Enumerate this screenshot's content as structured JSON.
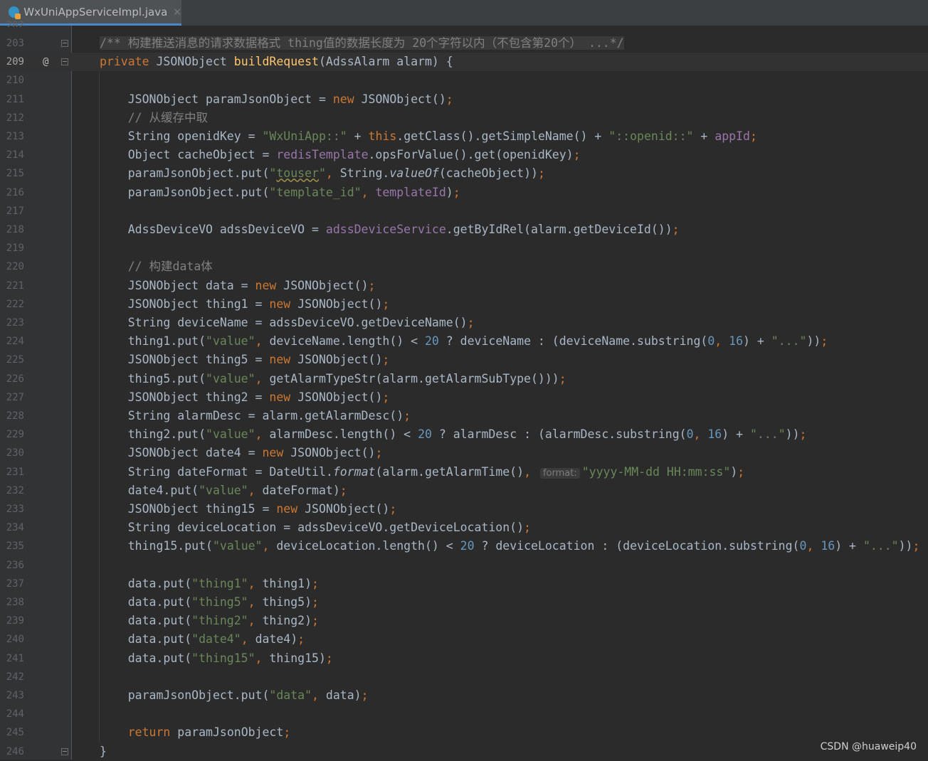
{
  "tab": {
    "filename": "WxUniAppServiceImpl.java",
    "close_icon": "×"
  },
  "watermark": "CSDN @huaweip40",
  "partial_line_number": "202",
  "lines": [
    {
      "n": "203",
      "fold": true,
      "tokens": [
        {
          "t": "/** 构建推送消息的请求数据格式 thing值的数据长度为 20个字符以内（不包含第20个） ...*/",
          "c": "cmt doc"
        }
      ]
    },
    {
      "n": "209",
      "current": true,
      "marker": "@",
      "fold": true,
      "tokens": [
        {
          "t": "private ",
          "c": "kw"
        },
        {
          "t": "JSONObject ",
          "c": "plain"
        },
        {
          "t": "buildRequest",
          "c": "fn"
        },
        {
          "t": "(AdssAlarm alarm) {",
          "c": "plain"
        }
      ]
    },
    {
      "n": "210",
      "tokens": []
    },
    {
      "n": "211",
      "tokens": [
        {
          "t": "    JSONObject paramJsonObject = ",
          "c": "plain"
        },
        {
          "t": "new ",
          "c": "kw"
        },
        {
          "t": "JSONObject()",
          "c": "plain"
        },
        {
          "t": ";",
          "c": "kw"
        }
      ]
    },
    {
      "n": "212",
      "tokens": [
        {
          "t": "    // 从缓存中取",
          "c": "cmt"
        }
      ]
    },
    {
      "n": "213",
      "tokens": [
        {
          "t": "    String openidKey = ",
          "c": "plain"
        },
        {
          "t": "\"WxUniApp::\"",
          "c": "str"
        },
        {
          "t": " + ",
          "c": "plain"
        },
        {
          "t": "this",
          "c": "kw"
        },
        {
          "t": ".getClass().getSimpleName() + ",
          "c": "plain"
        },
        {
          "t": "\"::openid::\"",
          "c": "str"
        },
        {
          "t": " + ",
          "c": "plain"
        },
        {
          "t": "appId",
          "c": "fld"
        },
        {
          "t": ";",
          "c": "kw"
        }
      ]
    },
    {
      "n": "214",
      "tokens": [
        {
          "t": "    Object cacheObject = ",
          "c": "plain"
        },
        {
          "t": "redisTemplate",
          "c": "fld"
        },
        {
          "t": ".opsForValue().get(openidKey)",
          "c": "plain"
        },
        {
          "t": ";",
          "c": "kw"
        }
      ]
    },
    {
      "n": "215",
      "tokens": [
        {
          "t": "    paramJsonObject.put(",
          "c": "plain"
        },
        {
          "t": "\"",
          "c": "str"
        },
        {
          "t": "touser",
          "c": "str ul"
        },
        {
          "t": "\"",
          "c": "str"
        },
        {
          "t": ", ",
          "c": "kw"
        },
        {
          "t": "String.",
          "c": "plain"
        },
        {
          "t": "valueOf",
          "c": "plain it"
        },
        {
          "t": "(cacheObject))",
          "c": "plain"
        },
        {
          "t": ";",
          "c": "kw"
        }
      ]
    },
    {
      "n": "216",
      "tokens": [
        {
          "t": "    paramJsonObject.put(",
          "c": "plain"
        },
        {
          "t": "\"template_id\"",
          "c": "str"
        },
        {
          "t": ", ",
          "c": "kw"
        },
        {
          "t": "templateId",
          "c": "fld"
        },
        {
          "t": ")",
          "c": "plain"
        },
        {
          "t": ";",
          "c": "kw"
        }
      ]
    },
    {
      "n": "217",
      "tokens": []
    },
    {
      "n": "218",
      "tokens": [
        {
          "t": "    AdssDeviceVO adssDeviceVO = ",
          "c": "plain"
        },
        {
          "t": "adssDeviceService",
          "c": "fld"
        },
        {
          "t": ".getByIdRel(alarm.getDeviceId())",
          "c": "plain"
        },
        {
          "t": ";",
          "c": "kw"
        }
      ]
    },
    {
      "n": "219",
      "tokens": []
    },
    {
      "n": "220",
      "tokens": [
        {
          "t": "    // 构建data体",
          "c": "cmt"
        }
      ]
    },
    {
      "n": "221",
      "tokens": [
        {
          "t": "    JSONObject data = ",
          "c": "plain"
        },
        {
          "t": "new ",
          "c": "kw"
        },
        {
          "t": "JSONObject()",
          "c": "plain"
        },
        {
          "t": ";",
          "c": "kw"
        }
      ]
    },
    {
      "n": "222",
      "tokens": [
        {
          "t": "    JSONObject thing1 = ",
          "c": "plain"
        },
        {
          "t": "new ",
          "c": "kw"
        },
        {
          "t": "JSONObject()",
          "c": "plain"
        },
        {
          "t": ";",
          "c": "kw"
        }
      ]
    },
    {
      "n": "223",
      "tokens": [
        {
          "t": "    String deviceName = adssDeviceVO.getDeviceName()",
          "c": "plain"
        },
        {
          "t": ";",
          "c": "kw"
        }
      ]
    },
    {
      "n": "224",
      "tokens": [
        {
          "t": "    thing1.put(",
          "c": "plain"
        },
        {
          "t": "\"value\"",
          "c": "str"
        },
        {
          "t": ", ",
          "c": "kw"
        },
        {
          "t": "deviceName.length() < ",
          "c": "plain"
        },
        {
          "t": "20",
          "c": "num"
        },
        {
          "t": " ? deviceName : (deviceName.substring(",
          "c": "plain"
        },
        {
          "t": "0",
          "c": "num"
        },
        {
          "t": ", ",
          "c": "kw"
        },
        {
          "t": "16",
          "c": "num"
        },
        {
          "t": ") + ",
          "c": "plain"
        },
        {
          "t": "\"...\"",
          "c": "str"
        },
        {
          "t": "))",
          "c": "plain"
        },
        {
          "t": ";",
          "c": "kw"
        }
      ]
    },
    {
      "n": "225",
      "tokens": [
        {
          "t": "    JSONObject thing5 = ",
          "c": "plain"
        },
        {
          "t": "new ",
          "c": "kw"
        },
        {
          "t": "JSONObject()",
          "c": "plain"
        },
        {
          "t": ";",
          "c": "kw"
        }
      ]
    },
    {
      "n": "226",
      "tokens": [
        {
          "t": "    thing5.put(",
          "c": "plain"
        },
        {
          "t": "\"value\"",
          "c": "str"
        },
        {
          "t": ", ",
          "c": "kw"
        },
        {
          "t": "getAlarmTypeStr(alarm.getAlarmSubType()))",
          "c": "plain"
        },
        {
          "t": ";",
          "c": "kw"
        }
      ]
    },
    {
      "n": "227",
      "tokens": [
        {
          "t": "    JSONObject thing2 = ",
          "c": "plain"
        },
        {
          "t": "new ",
          "c": "kw"
        },
        {
          "t": "JSONObject()",
          "c": "plain"
        },
        {
          "t": ";",
          "c": "kw"
        }
      ]
    },
    {
      "n": "228",
      "tokens": [
        {
          "t": "    String alarmDesc = alarm.getAlarmDesc()",
          "c": "plain"
        },
        {
          "t": ";",
          "c": "kw"
        }
      ]
    },
    {
      "n": "229",
      "tokens": [
        {
          "t": "    thing2.put(",
          "c": "plain"
        },
        {
          "t": "\"value\"",
          "c": "str"
        },
        {
          "t": ", ",
          "c": "kw"
        },
        {
          "t": "alarmDesc.length() < ",
          "c": "plain"
        },
        {
          "t": "20",
          "c": "num"
        },
        {
          "t": " ? alarmDesc : (alarmDesc.substring(",
          "c": "plain"
        },
        {
          "t": "0",
          "c": "num"
        },
        {
          "t": ", ",
          "c": "kw"
        },
        {
          "t": "16",
          "c": "num"
        },
        {
          "t": ") + ",
          "c": "plain"
        },
        {
          "t": "\"...\"",
          "c": "str"
        },
        {
          "t": "))",
          "c": "plain"
        },
        {
          "t": ";",
          "c": "kw"
        }
      ]
    },
    {
      "n": "230",
      "tokens": [
        {
          "t": "    JSONObject date4 = ",
          "c": "plain"
        },
        {
          "t": "new ",
          "c": "kw"
        },
        {
          "t": "JSONObject()",
          "c": "plain"
        },
        {
          "t": ";",
          "c": "kw"
        }
      ]
    },
    {
      "n": "231",
      "tokens": [
        {
          "t": "    String dateFormat = DateUtil.",
          "c": "plain"
        },
        {
          "t": "format",
          "c": "plain it"
        },
        {
          "t": "(alarm.getAlarmTime()",
          "c": "plain"
        },
        {
          "t": ", ",
          "c": "kw"
        },
        {
          "t": "format:",
          "c": "hint"
        },
        {
          "t": "\"yyyy-MM-dd HH:mm:ss\"",
          "c": "str"
        },
        {
          "t": ")",
          "c": "plain"
        },
        {
          "t": ";",
          "c": "kw"
        }
      ]
    },
    {
      "n": "232",
      "tokens": [
        {
          "t": "    date4.put(",
          "c": "plain"
        },
        {
          "t": "\"value\"",
          "c": "str"
        },
        {
          "t": ", ",
          "c": "kw"
        },
        {
          "t": "dateFormat)",
          "c": "plain"
        },
        {
          "t": ";",
          "c": "kw"
        }
      ]
    },
    {
      "n": "233",
      "tokens": [
        {
          "t": "    JSONObject thing15 = ",
          "c": "plain"
        },
        {
          "t": "new ",
          "c": "kw"
        },
        {
          "t": "JSONObject()",
          "c": "plain"
        },
        {
          "t": ";",
          "c": "kw"
        }
      ]
    },
    {
      "n": "234",
      "tokens": [
        {
          "t": "    String deviceLocation = adssDeviceVO.getDeviceLocation()",
          "c": "plain"
        },
        {
          "t": ";",
          "c": "kw"
        }
      ]
    },
    {
      "n": "235",
      "tokens": [
        {
          "t": "    thing15.put(",
          "c": "plain"
        },
        {
          "t": "\"value\"",
          "c": "str"
        },
        {
          "t": ", ",
          "c": "kw"
        },
        {
          "t": "deviceLocation.length() < ",
          "c": "plain"
        },
        {
          "t": "20",
          "c": "num"
        },
        {
          "t": " ? deviceLocation : (deviceLocation.substring(",
          "c": "plain"
        },
        {
          "t": "0",
          "c": "num"
        },
        {
          "t": ", ",
          "c": "kw"
        },
        {
          "t": "16",
          "c": "num"
        },
        {
          "t": ") + ",
          "c": "plain"
        },
        {
          "t": "\"...\"",
          "c": "str"
        },
        {
          "t": "))",
          "c": "plain"
        },
        {
          "t": ";",
          "c": "kw"
        }
      ]
    },
    {
      "n": "236",
      "tokens": []
    },
    {
      "n": "237",
      "tokens": [
        {
          "t": "    data.put(",
          "c": "plain"
        },
        {
          "t": "\"thing1\"",
          "c": "str"
        },
        {
          "t": ", ",
          "c": "kw"
        },
        {
          "t": "thing1)",
          "c": "plain"
        },
        {
          "t": ";",
          "c": "kw"
        }
      ]
    },
    {
      "n": "238",
      "tokens": [
        {
          "t": "    data.put(",
          "c": "plain"
        },
        {
          "t": "\"thing5\"",
          "c": "str"
        },
        {
          "t": ", ",
          "c": "kw"
        },
        {
          "t": "thing5)",
          "c": "plain"
        },
        {
          "t": ";",
          "c": "kw"
        }
      ]
    },
    {
      "n": "239",
      "tokens": [
        {
          "t": "    data.put(",
          "c": "plain"
        },
        {
          "t": "\"thing2\"",
          "c": "str"
        },
        {
          "t": ", ",
          "c": "kw"
        },
        {
          "t": "thing2)",
          "c": "plain"
        },
        {
          "t": ";",
          "c": "kw"
        }
      ]
    },
    {
      "n": "240",
      "tokens": [
        {
          "t": "    data.put(",
          "c": "plain"
        },
        {
          "t": "\"date4\"",
          "c": "str"
        },
        {
          "t": ", ",
          "c": "kw"
        },
        {
          "t": "date4)",
          "c": "plain"
        },
        {
          "t": ";",
          "c": "kw"
        }
      ]
    },
    {
      "n": "241",
      "tokens": [
        {
          "t": "    data.put(",
          "c": "plain"
        },
        {
          "t": "\"thing15\"",
          "c": "str"
        },
        {
          "t": ", ",
          "c": "kw"
        },
        {
          "t": "thing15)",
          "c": "plain"
        },
        {
          "t": ";",
          "c": "kw"
        }
      ]
    },
    {
      "n": "242",
      "tokens": []
    },
    {
      "n": "243",
      "tokens": [
        {
          "t": "    paramJsonObject.put(",
          "c": "plain"
        },
        {
          "t": "\"data\"",
          "c": "str"
        },
        {
          "t": ", ",
          "c": "kw"
        },
        {
          "t": "data)",
          "c": "plain"
        },
        {
          "t": ";",
          "c": "kw"
        }
      ]
    },
    {
      "n": "244",
      "tokens": []
    },
    {
      "n": "245",
      "tokens": [
        {
          "t": "    ",
          "c": "plain"
        },
        {
          "t": "return ",
          "c": "kw"
        },
        {
          "t": "paramJsonObject",
          "c": "plain"
        },
        {
          "t": ";",
          "c": "kw"
        }
      ]
    },
    {
      "n": "246",
      "fold": true,
      "tokens": [
        {
          "t": "}",
          "c": "plain"
        }
      ]
    }
  ]
}
